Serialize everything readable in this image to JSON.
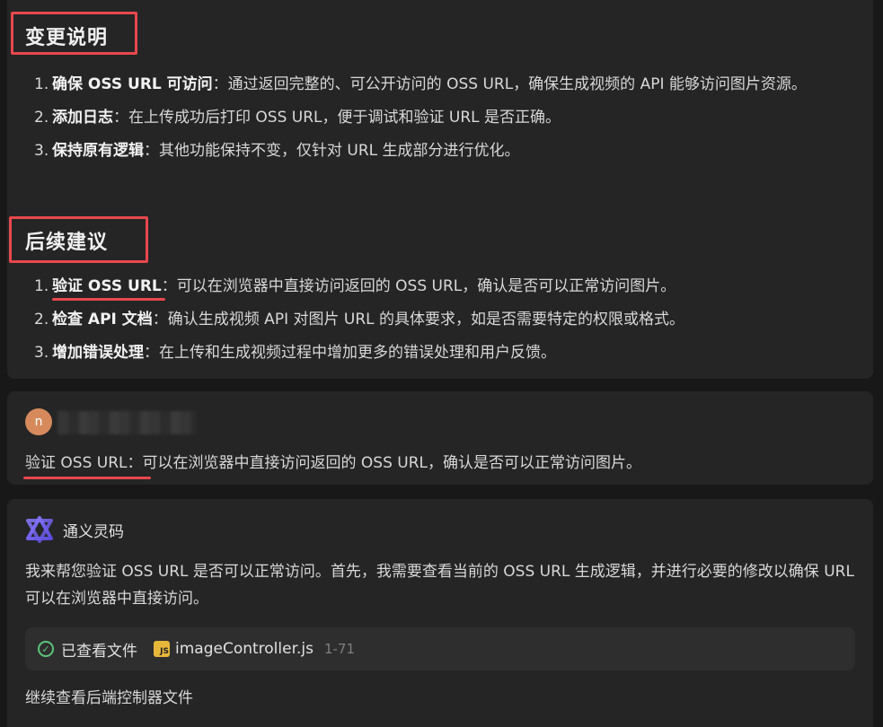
{
  "section1": {
    "title": "变更说明",
    "items": [
      {
        "num": "1.",
        "bold": "确保 OSS URL 可访问",
        "sep": "：",
        "text": "通过返回完整的、可公开访问的 OSS URL，确保生成视频的 API 能够访问图片资源。"
      },
      {
        "num": "2.",
        "bold": "添加日志",
        "sep": "：",
        "text": "在上传成功后打印 OSS URL，便于调试和验证 URL 是否正确。"
      },
      {
        "num": "3.",
        "bold": "保持原有逻辑",
        "sep": "：",
        "text": "其他功能保持不变，仅针对 URL 生成部分进行优化。"
      }
    ]
  },
  "section2": {
    "title": "后续建议",
    "items": [
      {
        "num": "1.",
        "bold": "验证 OSS URL",
        "sep": "：",
        "text": "可以在浏览器中直接访问返回的 OSS URL，确认是否可以正常访问图片。"
      },
      {
        "num": "2.",
        "bold": "检查 API 文档",
        "sep": "：",
        "text": "确认生成视频 API 对图片 URL 的具体要求，如是否需要特定的权限或格式。"
      },
      {
        "num": "3.",
        "bold": "增加错误处理",
        "sep": "：",
        "text": "在上传和生成视频过程中增加更多的错误处理和用户反馈。"
      }
    ]
  },
  "user_message": {
    "avatar_letter": "n",
    "text": "验证 OSS URL：可以在浏览器中直接访问返回的 OSS URL，确认是否可以正常访问图片。"
  },
  "assistant": {
    "name": "通义灵码",
    "logo_icon": "tongyi-lingma-logo",
    "reply": "我来帮您验证 OSS URL 是否可以正常访问。首先，我需要查看当前的 OSS URL 生成逻辑，并进行必要的修改以确保 URL 可以在浏览器中直接访问。",
    "file_chip": {
      "status": "已查看文件",
      "file_icon_label": "JS",
      "file_name": "imageController.js",
      "range": "1-71"
    },
    "followup": "继续查看后端控制器文件"
  },
  "colors": {
    "background": "#181818",
    "card": "#252526",
    "annotation_red": "#e8484d",
    "check_green": "#5cc57a",
    "js_yellow": "#e8b73a",
    "avatar_orange": "#d68a5c"
  }
}
